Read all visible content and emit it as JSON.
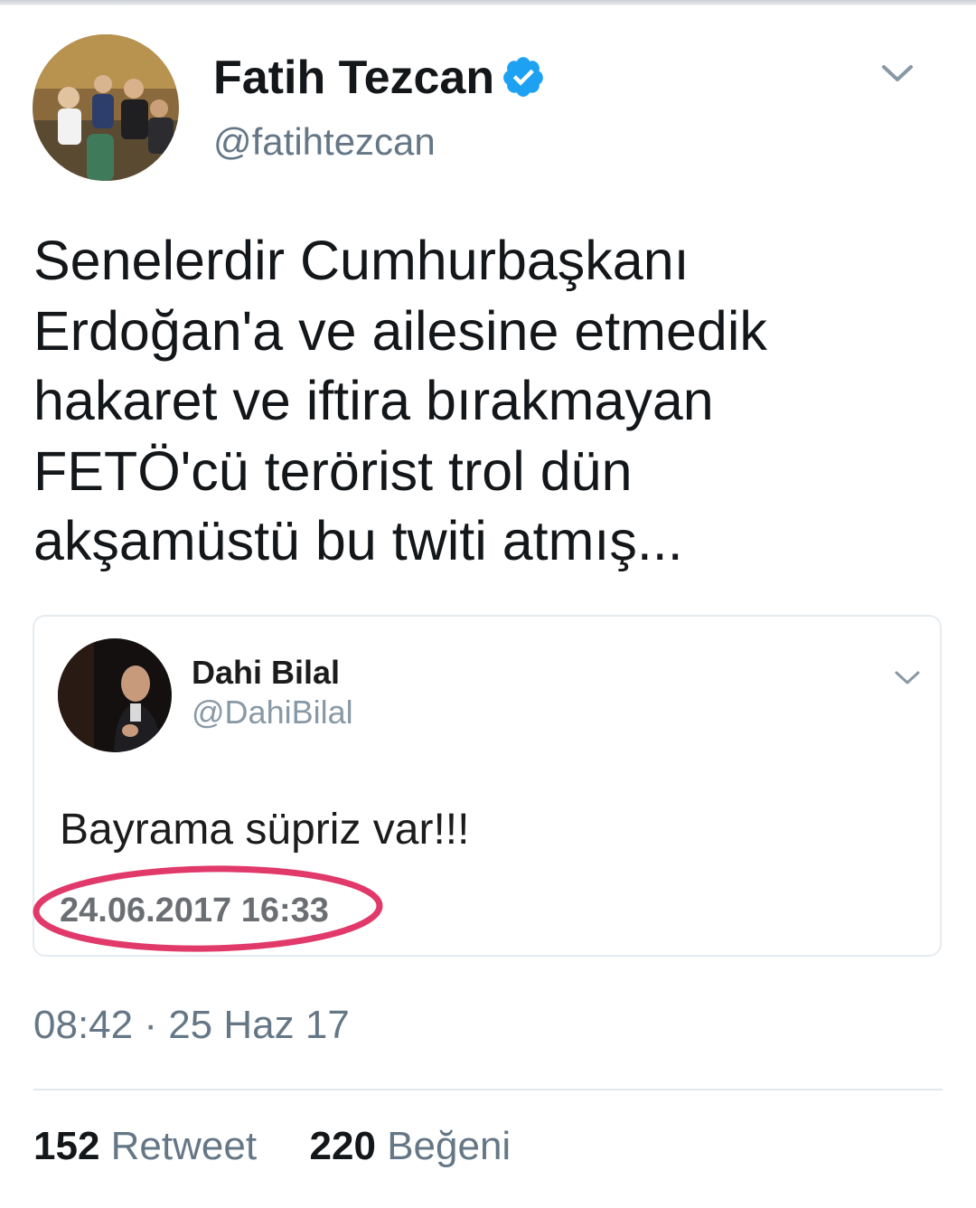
{
  "tweet": {
    "author": {
      "display_name": "Fatih Tezcan",
      "handle": "@fatihtezcan",
      "verified": true
    },
    "text": "Senelerdir Cumhurbaşkanı\nErdoğan'a ve ailesine etmedik\nhakaret ve iftira bırakmayan\nFETÖ'cü terörist trol dün\nakşamüstü bu twiti atmış...",
    "timestamp": "08:42 · 25 Haz 17",
    "stats": {
      "retweet_count": "152",
      "retweet_label": "Retweet",
      "like_count": "220",
      "like_label": "Beğeni"
    }
  },
  "quoted_tweet": {
    "author": {
      "display_name": "Dahi Bilal",
      "handle": "@DahiBilal"
    },
    "text": "Bayrama süpriz var!!!",
    "date": "24.06.2017 16:33"
  },
  "icons": {
    "verified": "verified-badge-icon",
    "menu": "chevron-down-icon"
  },
  "colors": {
    "accent": "#1da1f2",
    "secondary_text": "#657786",
    "highlight": "#e0396a"
  }
}
